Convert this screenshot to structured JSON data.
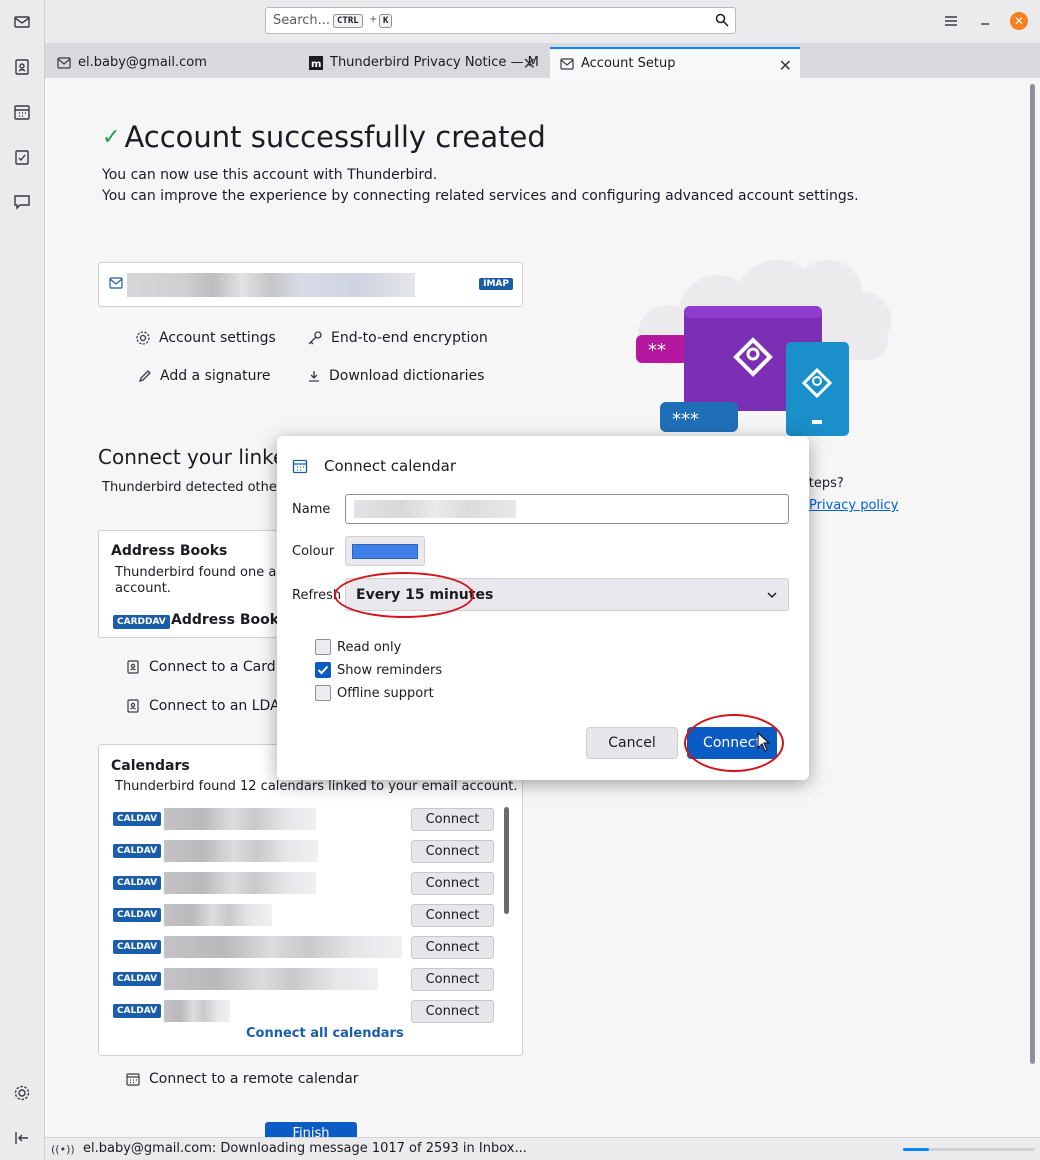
{
  "search": {
    "placeholder": "Search...",
    "key1": "CTRL",
    "plus": "+",
    "key2": "K"
  },
  "tabs": [
    {
      "label": "el.baby@gmail.com",
      "icon": "mail-icon"
    },
    {
      "label": "Thunderbird Privacy Notice — M",
      "icon": "mozilla-icon"
    },
    {
      "label": "Account Setup",
      "icon": "mail-icon",
      "active": true
    }
  ],
  "setup": {
    "title": "Account successfully created",
    "line1": "You can now use this account with Thunderbird.",
    "line2": "You can improve the experience by connecting related services and configuring advanced account settings.",
    "account_badge": "IMAP",
    "actions": {
      "account_settings": "Account settings",
      "e2e": "End-to-end encryption",
      "signature": "Add a signature",
      "dictionaries": "Download dictionaries"
    },
    "connect_heading": "Connect your linke",
    "detected": "Thunderbird detected other s",
    "next_steps": "steps?",
    "privacy_link": "Privacy policy"
  },
  "address_books": {
    "title": "Address Books",
    "text_line1": "Thunderbird found one add",
    "text_line2": "account.",
    "badge": "CARDDAV",
    "name": "Address Book",
    "link_carddav": "Connect to a CardD",
    "link_ldap": "Connect to an LDAP"
  },
  "calendars": {
    "title": "Calendars",
    "text": "Thunderbird found 12 calendars linked to your email account.",
    "badge": "CALDAV",
    "connect_label": "Connect",
    "connect_all": "Connect all calendars",
    "remote": "Connect to a remote calendar"
  },
  "finish_label": "Finish",
  "dialog": {
    "title": "Connect calendar",
    "name_label": "Name",
    "colour_label": "Colour",
    "colour_value": "#3f7de7",
    "refresh_label": "Refresh",
    "refresh_value": "Every 15 minutes",
    "read_only": "Read only",
    "read_only_checked": false,
    "show_reminders": "Show reminders",
    "show_reminders_checked": true,
    "offline": "Offline support",
    "offline_checked": false,
    "cancel": "Cancel",
    "connect": "Connect"
  },
  "status": {
    "text": "el.baby@gmail.com: Downloading message 1017 of 2593 in Inbox...",
    "progress": 0.2
  }
}
